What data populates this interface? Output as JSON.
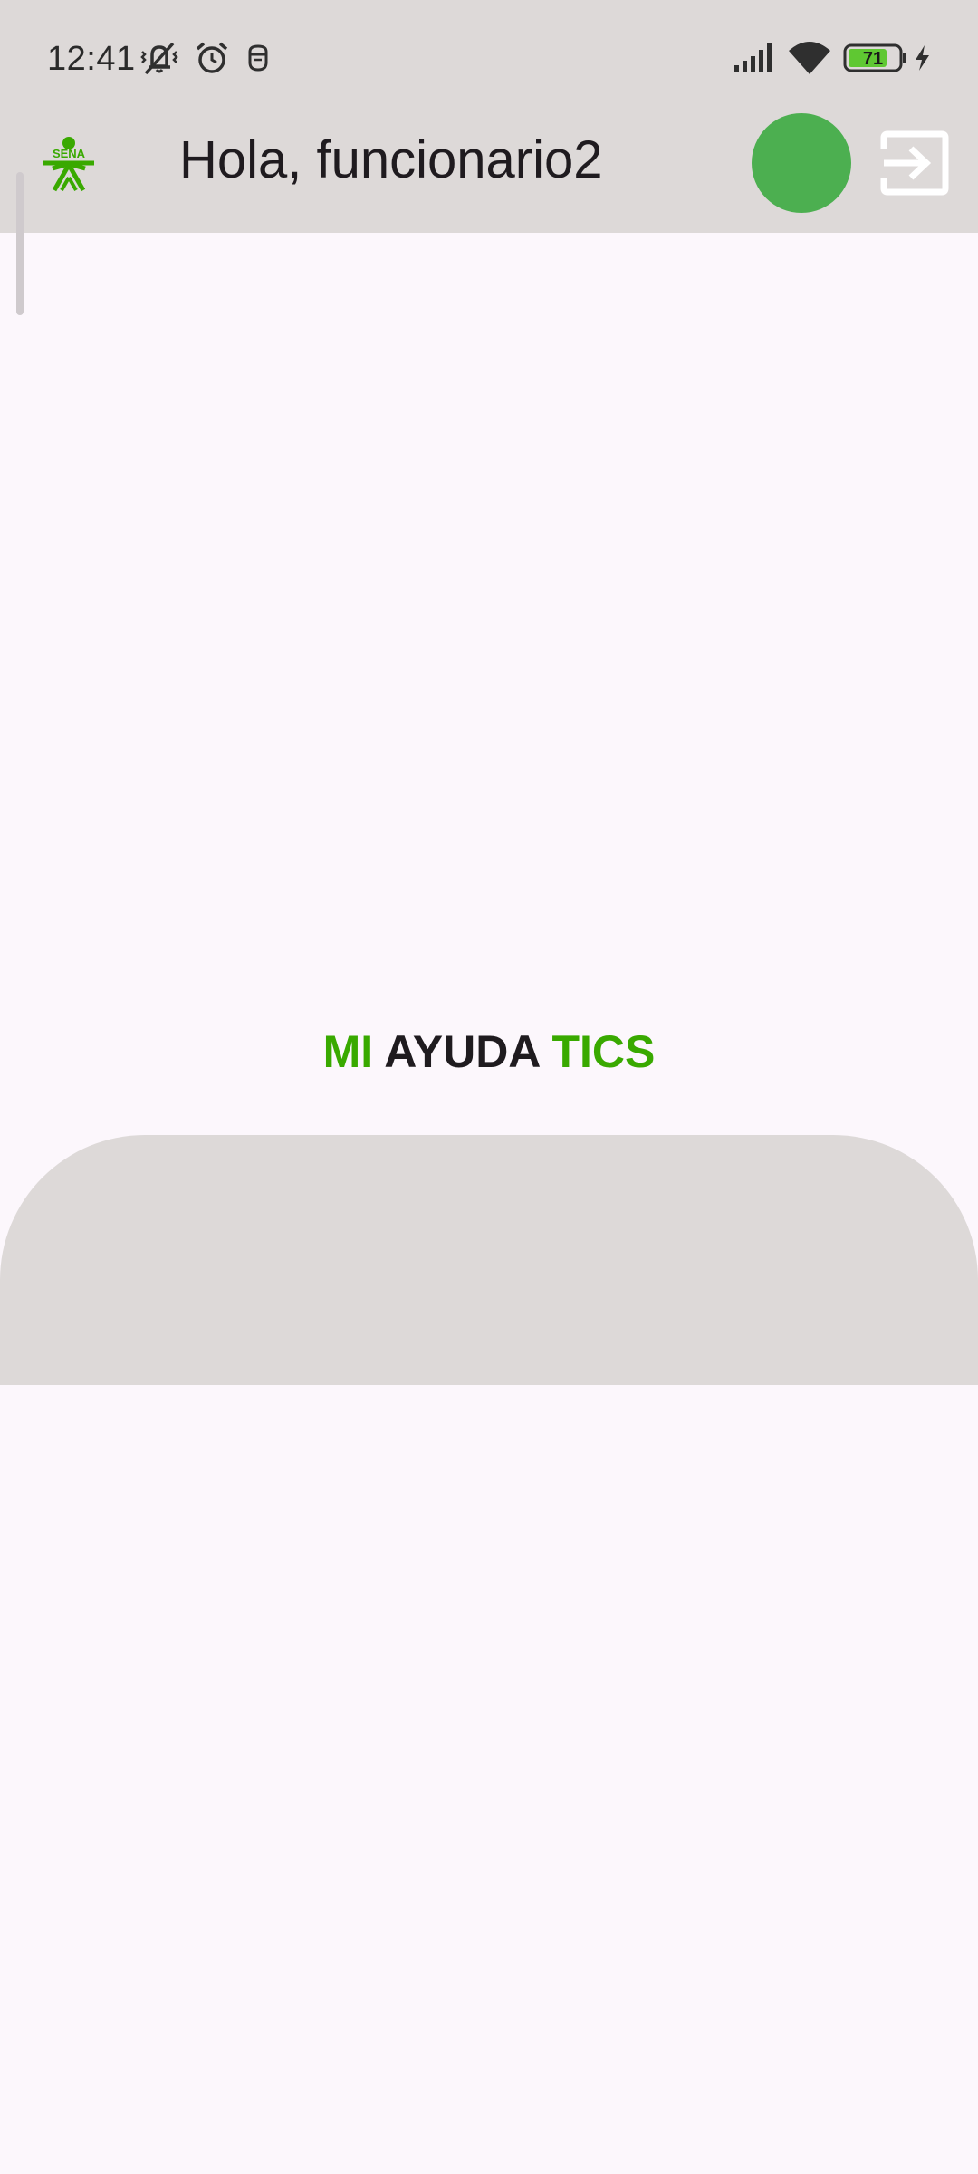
{
  "status_bar": {
    "time": "12:41",
    "icons": [
      "mute-vibrate-icon",
      "alarm-icon",
      "privacy-icon",
      "signal-icon",
      "wifi-icon",
      "battery-icon",
      "charging-icon"
    ],
    "battery_level": "71"
  },
  "app_bar": {
    "logo_text": "SENA",
    "greeting": "Hola, funcionario2",
    "avatar_color": "#4caf50",
    "logout_icon": "logout-icon"
  },
  "title": {
    "part1": "MI",
    "part2": "AYUDA",
    "part3": "TICS",
    "accent_color": "#39a900"
  },
  "colors": {
    "background": "#fcf7fc",
    "surface": "#ddd9d8",
    "brand_green": "#39a900"
  }
}
